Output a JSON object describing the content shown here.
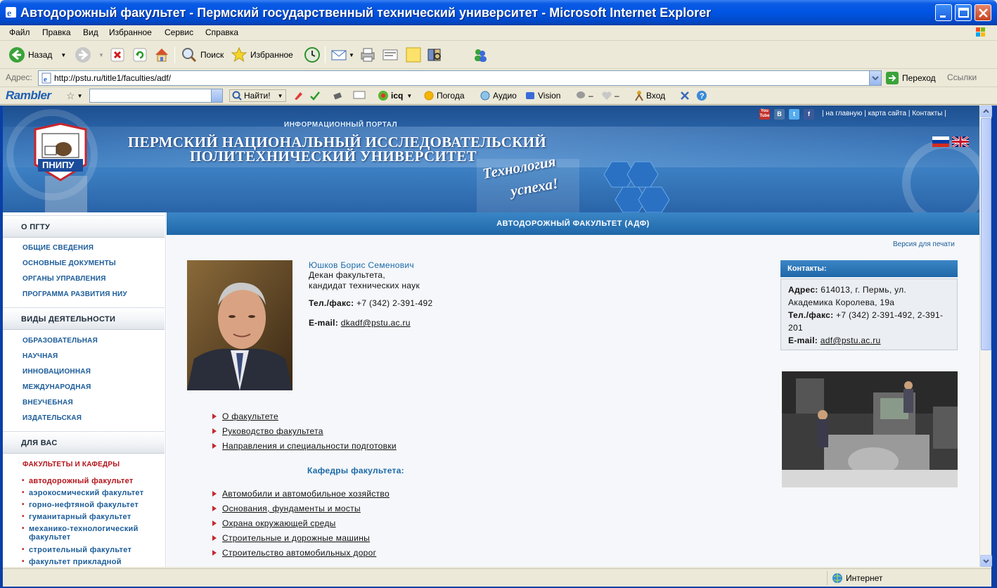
{
  "window": {
    "title": "Автодорожный факультет - Пермский государственный технический университет - Microsoft Internet Explorer"
  },
  "menu": [
    "Файл",
    "Правка",
    "Вид",
    "Избранное",
    "Сервис",
    "Справка"
  ],
  "toolbar": {
    "back": "Назад",
    "search": "Поиск",
    "favorites": "Избранное"
  },
  "address": {
    "label": "Адрес:",
    "url": "http://pstu.ru/title1/faculties/adf/",
    "go": "Переход",
    "links": "Ссылки"
  },
  "rambler": {
    "logo": "Rambler",
    "find": "Найти!",
    "icq": "icq",
    "weather": "Погода",
    "audio": "Аудио",
    "vision": "Vision",
    "dash1": "–",
    "dash2": "–",
    "login": "Вход"
  },
  "site": {
    "portal_label": "ИНФОРМАЦИОННЫЙ ПОРТАЛ",
    "uni_line1": "ПЕРМСКИЙ НАЦИОНАЛЬНЫЙ ИССЛЕДОВАТЕЛЬСКИЙ",
    "uni_line2": "ПОЛИТЕХНИЧЕСКИЙ УНИВЕРСИТЕТ",
    "logo_text": "ПНИПУ",
    "slogan_line1": "Технология",
    "slogan_line2": "успеха!",
    "top_links": {
      "home": "на главную",
      "sitemap": "карта сайта",
      "contacts": "Контакты"
    },
    "social": [
      "You Tube",
      "В",
      "t",
      "f"
    ]
  },
  "left_menu": {
    "sections": [
      {
        "title": "О ПГТУ",
        "items": [
          "ОБЩИЕ СВЕДЕНИЯ",
          "ОСНОВНЫЕ ДОКУМЕНТЫ",
          "ОРГАНЫ УПРАВЛЕНИЯ",
          "ПРОГРАММА РАЗВИТИЯ НИУ"
        ]
      },
      {
        "title": "ВИДЫ ДЕЯТЕЛЬНОСТИ",
        "items": [
          "ОБРАЗОВАТЕЛЬНАЯ",
          "НАУЧНАЯ",
          "ИННОВАЦИОННАЯ",
          "МЕЖДУНАРОДНАЯ",
          "ВНЕУЧЕБНАЯ",
          "ИЗДАТЕЛЬСКАЯ"
        ]
      },
      {
        "title": "ДЛЯ ВАС",
        "items": [
          "ФАКУЛЬТЕТЫ И КАФЕДРЫ"
        ]
      }
    ],
    "faculties": [
      "автодорожный факультет",
      "аэрокосмический факультет",
      "горно-нефтяной факультет",
      "гуманитарный факультет",
      "механико-технологический факультет",
      "строительный факультет",
      "факультет прикладной"
    ]
  },
  "main": {
    "header": "АВТОДОРОЖНЫЙ ФАКУЛЬТЕТ (АДФ)",
    "print_version": "Версия для печати",
    "dean": {
      "name": "Юшков Борис Семенович",
      "role_line1": "Декан факультета,",
      "role_line2": "кандидат технических наук",
      "tel_label": "Тел./факс:",
      "tel": "+7 (342) 2-391-492",
      "email_label": "E-mail:",
      "email": "dkadf@pstu.ac.ru"
    },
    "contacts": {
      "title": "Контакты:",
      "address_label": "Адрес:",
      "address": "614013, г. Пермь, ул. Академика Королева, 19а",
      "tel_label": "Тел./факс:",
      "tel": "+7 (342) 2-391-492, 2-391-201",
      "email_label": "E-mail:",
      "email": "adf@pstu.ac.ru"
    },
    "links": [
      "О факультете",
      "Руководство факультета",
      "Направления и специальности подготовки"
    ],
    "departments_title": "Кафедры факультета:",
    "departments": [
      "Автомобили и автомобильное хозяйство",
      "Основания, фундаменты и мосты",
      "Охрана окружающей среды",
      "Строительные и дорожные машины",
      "Строительство автомобильных дорог"
    ]
  },
  "status": {
    "zone": "Интернет"
  }
}
